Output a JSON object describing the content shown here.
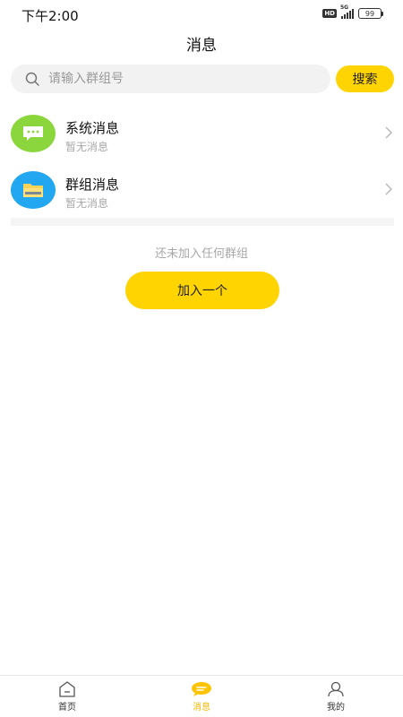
{
  "status_bar": {
    "time": "下午2:00",
    "hd": "HD",
    "network": "5G",
    "battery": "99"
  },
  "header": {
    "title": "消息"
  },
  "search": {
    "placeholder": "请输入群组号",
    "button_label": "搜索",
    "icon": "search-icon"
  },
  "messages": [
    {
      "name": "系统消息",
      "subtitle": "暂无消息",
      "icon": "chat-bubble-icon",
      "color": "#8bd63d"
    },
    {
      "name": "群组消息",
      "subtitle": "暂无消息",
      "icon": "folder-icon",
      "color": "#22a7f0"
    }
  ],
  "empty_state": {
    "text": "还未加入任何群组",
    "button_label": "加入一个"
  },
  "tab_bar": {
    "tabs": [
      {
        "label": "首页",
        "icon": "home-icon"
      },
      {
        "label": "消息",
        "icon": "message-icon",
        "active": true
      },
      {
        "label": "我的",
        "icon": "user-icon"
      }
    ]
  },
  "colors": {
    "accent": "#ffd400",
    "active_tab": "#ffb800"
  }
}
